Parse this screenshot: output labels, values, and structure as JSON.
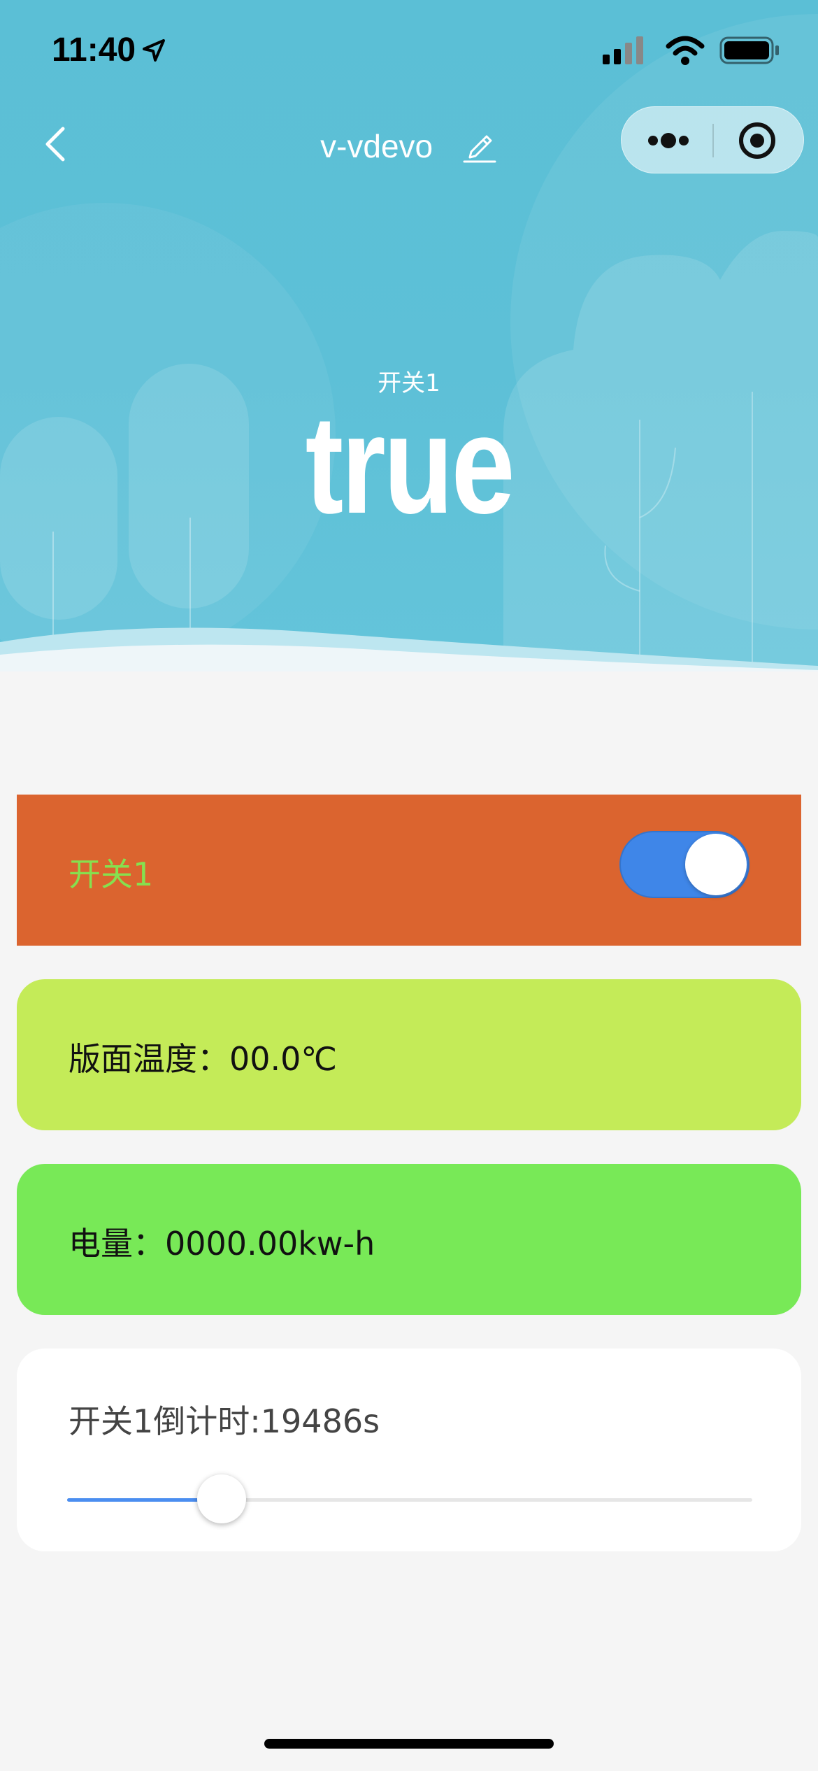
{
  "status_bar": {
    "time": "11:40",
    "icons": [
      "location-arrow-icon",
      "signal-icon",
      "wifi-icon",
      "battery-icon"
    ]
  },
  "nav": {
    "title": "v-vdevo",
    "back_icon": "chevron-left-icon",
    "edit_icon": "pencil-icon",
    "capsule_icons": [
      "more-dots-icon",
      "close-target-icon"
    ]
  },
  "hero": {
    "label": "开关1",
    "value": "true"
  },
  "switch_card": {
    "label": "开关1",
    "on": true,
    "colors": {
      "background": "#db642f",
      "label": "#86e04f",
      "toggle_on": "#3f86e8"
    }
  },
  "temp_card": {
    "label": "版面温度：",
    "value": "00.0℃",
    "color": "#c4eb58"
  },
  "power_card": {
    "label": "电量：",
    "value": "0000.00kw-h",
    "color": "#78e957"
  },
  "timer_card": {
    "label": "开关1倒计时:19486s",
    "slider_fraction": 0.225,
    "colors": {
      "fill": "#4b8ef0",
      "track": "#e6e6e6"
    }
  }
}
